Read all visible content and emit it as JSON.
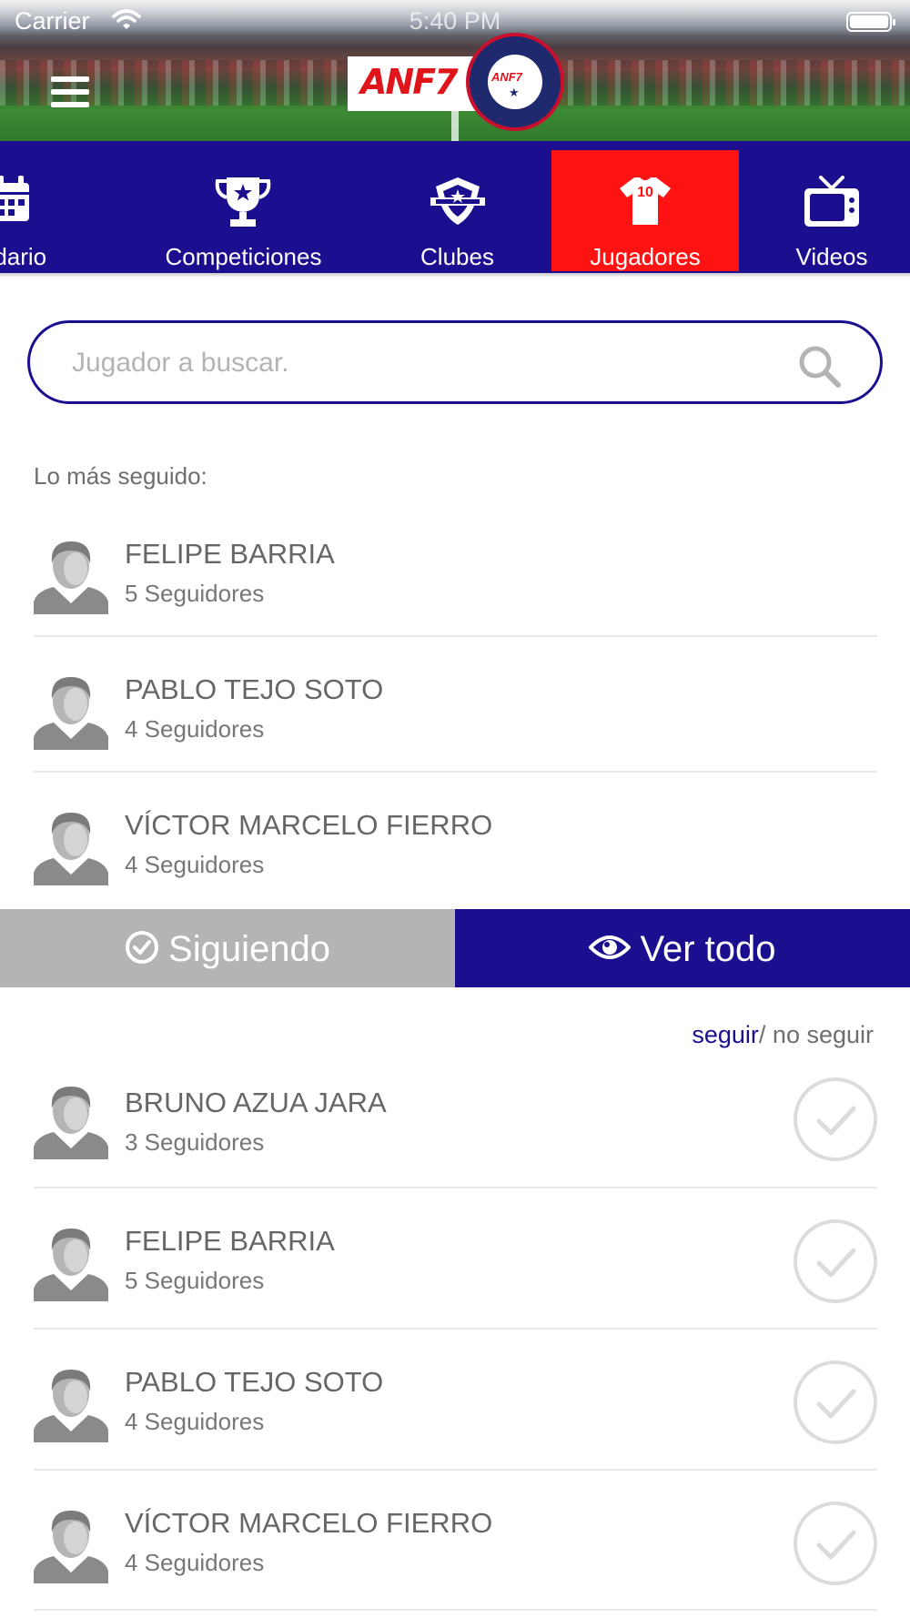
{
  "status_bar": {
    "carrier": "Carrier",
    "time": "5:40 PM"
  },
  "header": {
    "logo_text": "ANF7",
    "crest_text": "ANF7",
    "crest_star": "★"
  },
  "tabs": [
    {
      "label": "ndario",
      "icon": "calendar-icon",
      "active": false
    },
    {
      "label": "Competiciones",
      "icon": "trophy-icon",
      "active": false
    },
    {
      "label": "Clubes",
      "icon": "club-shield-icon",
      "active": false
    },
    {
      "label": "Jugadores",
      "icon": "jersey-icon",
      "active": true,
      "jersey_number": "10"
    },
    {
      "label": "Videos",
      "icon": "tv-icon",
      "active": false
    }
  ],
  "search": {
    "placeholder": "Jugador a buscar."
  },
  "most_followed": {
    "label": "Lo más seguido:",
    "players": [
      {
        "name": "FELIPE BARRIA",
        "followers": "5 Seguidores"
      },
      {
        "name": "PABLO TEJO SOTO",
        "followers": "4 Seguidores"
      },
      {
        "name": "VÍCTOR MARCELO FIERRO",
        "followers": "4 Seguidores"
      }
    ]
  },
  "segments": {
    "following_label": "Siguiendo",
    "view_all_label": "Ver todo"
  },
  "follow_legend": {
    "follow": "seguir",
    "unfollow": "/ no seguir"
  },
  "players": [
    {
      "name": "BRUNO AZUA JARA",
      "followers": "3 Seguidores"
    },
    {
      "name": "FELIPE BARRIA",
      "followers": "5 Seguidores"
    },
    {
      "name": "PABLO TEJO SOTO",
      "followers": "4 Seguidores"
    },
    {
      "name": "VÍCTOR MARCELO FIERRO",
      "followers": "4 Seguidores"
    }
  ],
  "colors": {
    "primary": "#1b0f8f",
    "active_tab": "#ff1212",
    "muted": "#b4b4b4"
  }
}
